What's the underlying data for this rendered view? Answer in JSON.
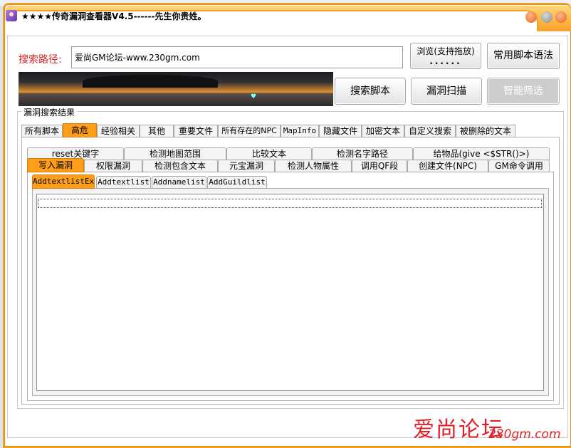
{
  "window": {
    "title": "★★★★传奇漏洞查看器V4.5------先生你贵姓。"
  },
  "search": {
    "path_label": "搜索路径:",
    "path_value": "爱尚GM论坛-www.230gm.com",
    "browse_label": "浏览(支持拖放)",
    "browse_dots": "......",
    "syntax_button": "常用脚本语法",
    "search_button": "搜索脚本",
    "scan_button": "漏洞扫描",
    "filter_button": "智能筛选"
  },
  "results": {
    "group_title": "漏洞搜索结果",
    "main_tabs": [
      "所有脚本",
      "高危",
      "经验相关",
      "其他",
      "重要文件",
      "所有存在的NPC",
      "MapInfo",
      "隐藏文件",
      "加密文本",
      "自定义搜索",
      "被删除的文本"
    ],
    "main_tab_active": "高危",
    "sub_tabs_row1": [
      "reset关键字",
      "检测地图范围",
      "比较文本",
      "检测名字路径",
      "给物品(give <$STR()>)"
    ],
    "sub_tabs_row2": [
      "写入漏洞",
      "权限漏洞",
      "检测包含文本",
      "元宝漏洞",
      "检测人物属性",
      "调用QF段",
      "创建文件(NPC)",
      "GM命令调用"
    ],
    "sub_tab_active": "写入漏洞",
    "detail_tabs": [
      "AddtextlistEx",
      "Addtextlist",
      "Addnamelist",
      "AddGuildlist"
    ],
    "detail_tab_active": "AddtextlistEx"
  },
  "watermark": {
    "text": "爱尚论坛",
    "url": "230gm.com"
  },
  "colors": {
    "accent_orange": "#ff9e18",
    "frame_orange": "#f5a021",
    "label_red": "#dd2222",
    "watermark_red": "#e41e26"
  }
}
